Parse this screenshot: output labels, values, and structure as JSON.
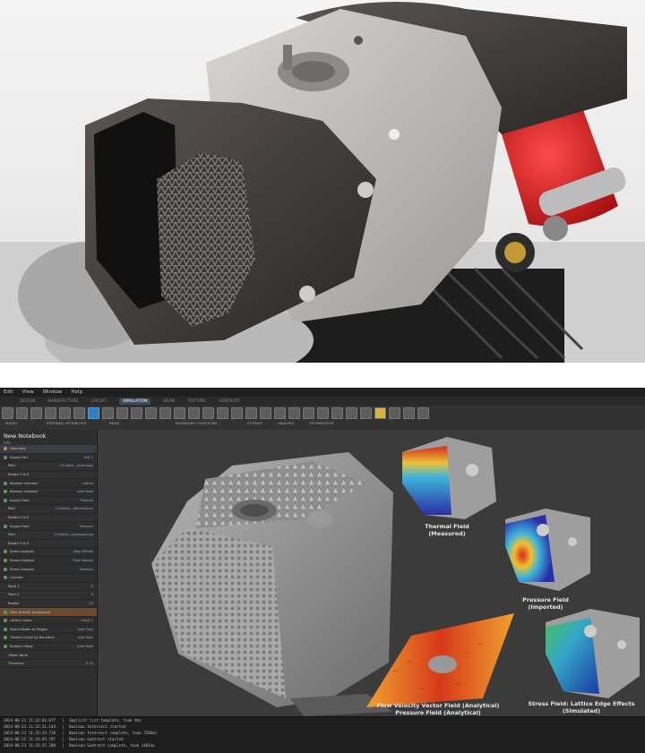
{
  "app": {
    "menu": [
      "Edit",
      "View",
      "Window",
      "Help"
    ],
    "tabs": [
      "DESIGN",
      "MANUFACTURE",
      "LAYOUT",
      "SIMULATION",
      "BEAM",
      "TEXTURE",
      "GENERATE"
    ],
    "active_tab": "SIMULATION",
    "toolbar_groups": [
      "MODEL",
      "EXTERNAL ATTRIBUTES",
      "BEAM",
      "BOUNDARY CONDITIONS",
      "STUDIES",
      "ANALYSIS",
      "OPTIMIZATION"
    ],
    "notebook": {
      "title": "New Notebook",
      "subtitle": "Info",
      "rows": [
        {
          "label": "Geometry",
          "value": "",
          "kind": "head"
        },
        {
          "label": "Import Part",
          "value": "Part 1",
          "kind": "row"
        },
        {
          "label": "Path",
          "value": "C:\\Users\\...\\Inlet.step",
          "kind": "sub"
        },
        {
          "label": "Rotate Y to Z",
          "value": "",
          "kind": "sub"
        },
        {
          "label": "Boolean Intersect",
          "value": "Lattice",
          "kind": "row"
        },
        {
          "label": "Boolean Subtract",
          "value": "Inlet Shell",
          "kind": "row"
        },
        {
          "label": "Import Field",
          "value": "Thermal",
          "kind": "row"
        },
        {
          "label": "Path",
          "value": "C:\\Users\\...\\thermal.csv",
          "kind": "sub"
        },
        {
          "label": "Rotate Y to Z",
          "value": "",
          "kind": "sub"
        },
        {
          "label": "Import Field",
          "value": "Pressure",
          "kind": "row"
        },
        {
          "label": "Path",
          "value": "C:\\Users\\...\\pressure.csv",
          "kind": "sub"
        },
        {
          "label": "Rotate Y to Z",
          "value": "",
          "kind": "sub"
        },
        {
          "label": "Stress Analysis",
          "value": "Edge Effects",
          "kind": "row"
        },
        {
          "label": "Stress Analysis",
          "value": "Flow Vectors",
          "kind": "row"
        },
        {
          "label": "Stress Analysis",
          "value": "Pressure",
          "kind": "row"
        },
        {
          "label": "Cylinder",
          "value": "",
          "kind": "row"
        },
        {
          "label": "Point 1",
          "value": "0",
          "kind": "sub"
        },
        {
          "label": "Point 2",
          "value": "0",
          "kind": "sub"
        },
        {
          "label": "Radius",
          "value": "10",
          "kind": "sub"
        },
        {
          "label": "Flow Velocity (Analytical)",
          "value": "",
          "kind": "highlight"
        },
        {
          "label": "Lattice Cubes",
          "value": "Cubic 1",
          "kind": "row"
        },
        {
          "label": "Select Nodes by Region",
          "value": "Inlet Face",
          "kind": "row"
        },
        {
          "label": "Thicken Graph by Boundary",
          "value": "Inlet Face",
          "kind": "row"
        },
        {
          "label": "Surface Offset",
          "value": "Inlet Shell",
          "kind": "row"
        },
        {
          "label": "Offset Value",
          "value": "",
          "kind": "sub"
        },
        {
          "label": "Thickness",
          "value": "0.25",
          "kind": "sub"
        }
      ]
    },
    "viewport": {
      "labels": [
        {
          "id": "thermal",
          "line1": "Thermal Field",
          "line2": "(Measured)"
        },
        {
          "id": "pressure",
          "line1": "Pressure Field",
          "line2": "(Imported)"
        },
        {
          "id": "flow",
          "line1": "Flow Velocity Vector Field (Analytical)",
          "line2": "Pressure Field (Analytical)"
        },
        {
          "id": "stress",
          "line1": "Stress Field: Lattice Edge Effects",
          "line2": "(Simulated)"
        }
      ]
    },
    "console": [
      "2024-08-21 11:32:03.877   |  Implicit list template, took 4ms",
      "2024-08-21 11:32:31.144   |  Boolean Intersect started",
      "2024-08-21 11:32:33.718   |  Boolean Intersect complete, took 2566ms",
      "2024-08-21 11:33:03.787   |  Boolean Subtract started",
      "2024-08-21 11:33:47.208   |  Boolean Subtract complete, took 1401ms"
    ]
  },
  "colors": {
    "accent": "#2f7fbf",
    "highlight": "#6a4a30",
    "heat_hot": "#d62a1a",
    "heat_cold": "#2a2fa8"
  }
}
